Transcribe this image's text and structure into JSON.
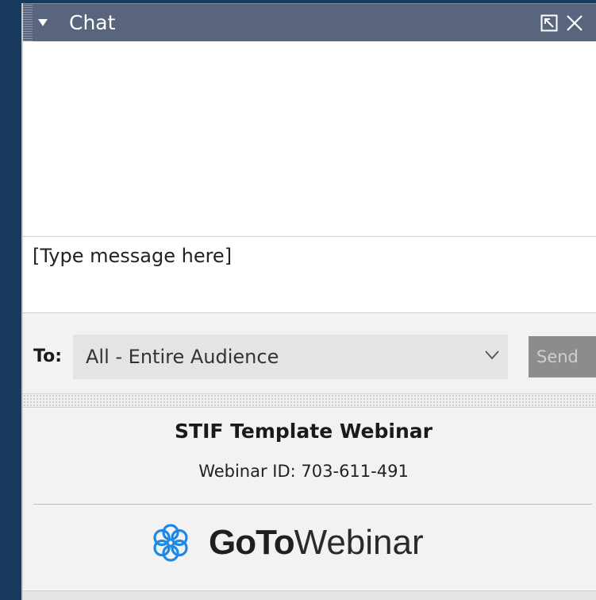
{
  "header": {
    "title": "Chat",
    "icons": [
      "collapse-arrow-icon",
      "popout-icon",
      "close-icon"
    ]
  },
  "message_input": {
    "placeholder": "[Type message here]"
  },
  "recipient": {
    "label": "To:",
    "selected": "All - Entire Audience"
  },
  "send": {
    "label": "Send"
  },
  "webinar": {
    "title": "STIF Template Webinar",
    "id_text": "Webinar ID: 703-611-491"
  },
  "brand": {
    "bold": "GoTo",
    "light": "Webinar",
    "icon": "gotowebinar-flower-icon",
    "color": "#1e88e5"
  },
  "colors": {
    "titlebar": "#59657d",
    "background": "#173a5c"
  }
}
